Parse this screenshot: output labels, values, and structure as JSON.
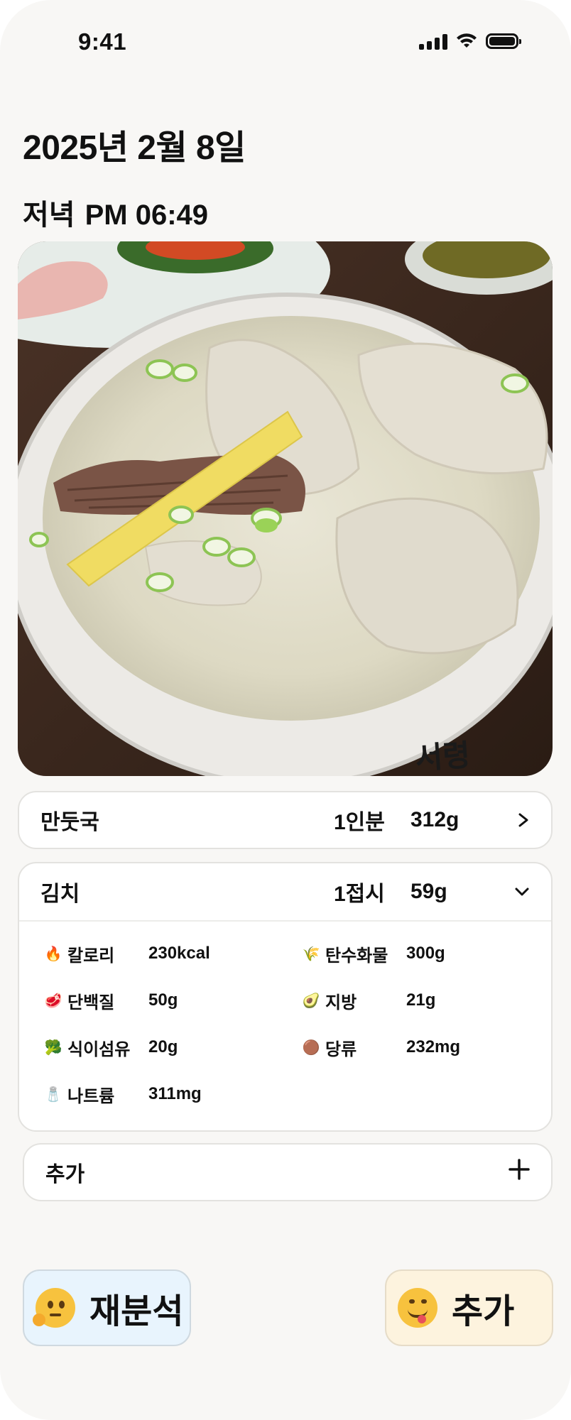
{
  "status_bar": {
    "time": "9:41"
  },
  "header": {
    "date": "2025년 2월 8일",
    "meal": "저녁",
    "time": "PM 06:49"
  },
  "foods": [
    {
      "name": "만둣국",
      "portion": "1인분",
      "weight": "312g",
      "expanded": false
    },
    {
      "name": "김치",
      "portion": "1접시",
      "weight": "59g",
      "expanded": true
    }
  ],
  "nutrition": [
    {
      "icon": "fire-icon",
      "label": "칼로리",
      "value": "230kcal"
    },
    {
      "icon": "grain-icon",
      "label": "탄수화물",
      "value": "300g"
    },
    {
      "icon": "meat-icon",
      "label": "단백질",
      "value": "50g"
    },
    {
      "icon": "avocado-icon",
      "label": "지방",
      "value": "21g"
    },
    {
      "icon": "broccoli-icon",
      "label": "식이섬유",
      "value": "20g"
    },
    {
      "icon": "sugar-icon",
      "label": "당류",
      "value": "232mg"
    },
    {
      "icon": "salt-shaker-icon",
      "label": "나트륨",
      "value": "311mg"
    }
  ],
  "add_row": {
    "label": "추가"
  },
  "buttons": {
    "reanalyze": "재분석",
    "add": "추가"
  },
  "photo": {
    "bowl_text": "서령"
  },
  "colors": {
    "background": "#f8f7f5",
    "reanalyze_bg": "#e8f4fd",
    "add_bg": "#fdf3de"
  }
}
